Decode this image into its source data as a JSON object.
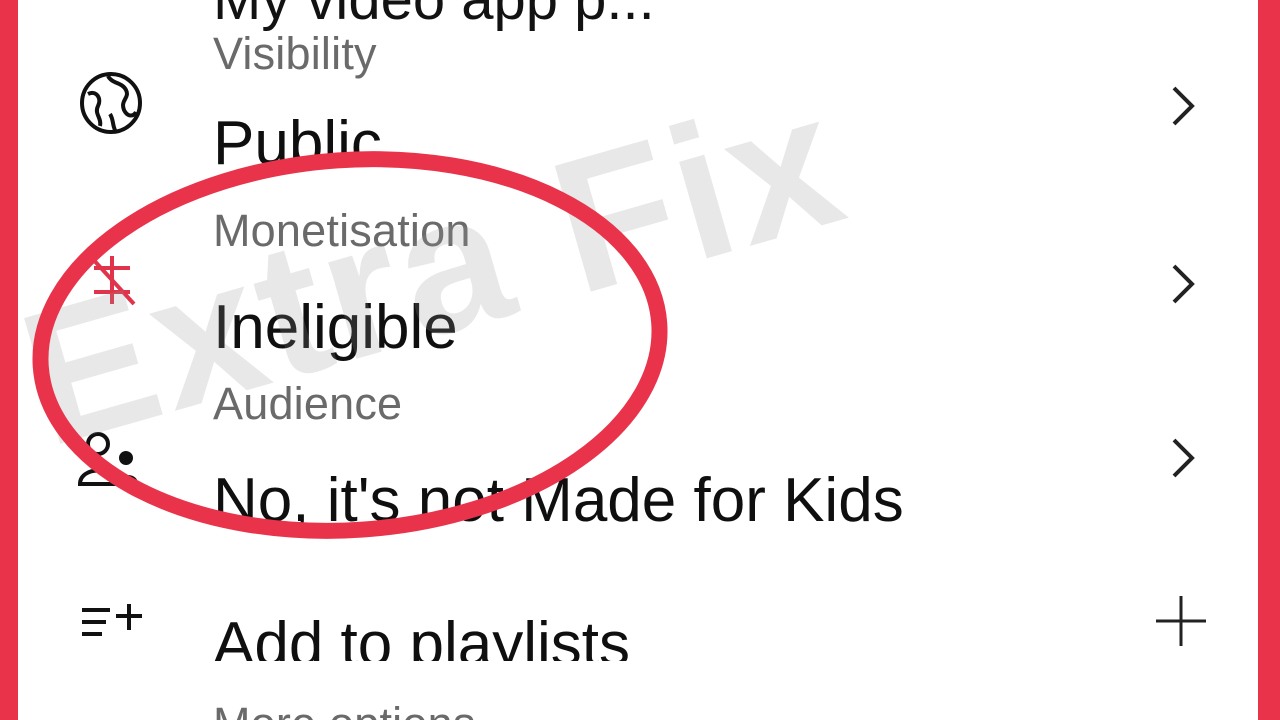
{
  "top_cut_text": "My video app p...",
  "rows": [
    {
      "label": "Visibility",
      "value": "Public",
      "icon": "globe-icon"
    },
    {
      "label": "Monetisation",
      "value": "Ineligible",
      "icon": "monetisation-off-icon"
    },
    {
      "label": "Audience",
      "value": "No, it's not Made for Kids",
      "icon": "audience-icon"
    }
  ],
  "playlist": {
    "value": "Add to playlists",
    "icon": "playlist-add-icon",
    "action_icon": "plus-icon"
  },
  "more_options": {
    "label": "More options"
  },
  "watermark": "Extra Fix",
  "colors": {
    "accent_red": "#e8334a",
    "text": "#0f0f0f",
    "label": "#6a6a6a",
    "monetisation_icon": "#e0344b"
  }
}
